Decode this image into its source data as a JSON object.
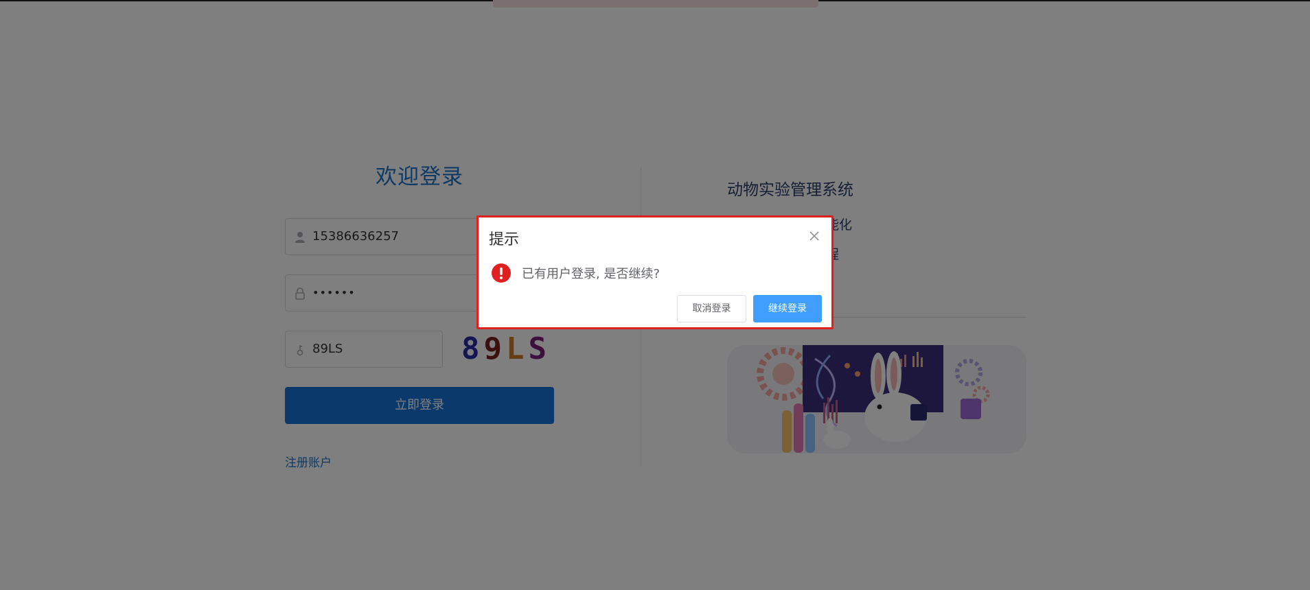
{
  "login": {
    "welcome": "欢迎登录",
    "username_value": "15386636257",
    "password_value": "••••••",
    "captcha_input_value": "89LS",
    "captcha_image": {
      "chars": [
        "8",
        "9",
        "L",
        "S"
      ],
      "colors": [
        "#2a2aa8",
        "#7a1f1f",
        "#c97a2a",
        "#7a1f7a"
      ]
    },
    "submit_label": "立即登录",
    "register_label": "注册账户"
  },
  "right_panel": {
    "system_title": "动物实验管理系统",
    "feature_line_1_visible_tail": "能化",
    "feature_line_2_visible_tail": "程"
  },
  "dialog": {
    "title": "提示",
    "message": "已有用户登录, 是否继续?",
    "cancel_label": "取消登录",
    "continue_label": "继续登录"
  },
  "colors": {
    "primary": "#1673d6",
    "dialog_primary": "#409eff",
    "warning": "#e02020",
    "highlight_border": "#e02020"
  },
  "icons": {
    "username": "user-icon",
    "password": "lock-icon",
    "captcha": "key-icon",
    "close": "close-icon",
    "warning": "warning-icon"
  }
}
